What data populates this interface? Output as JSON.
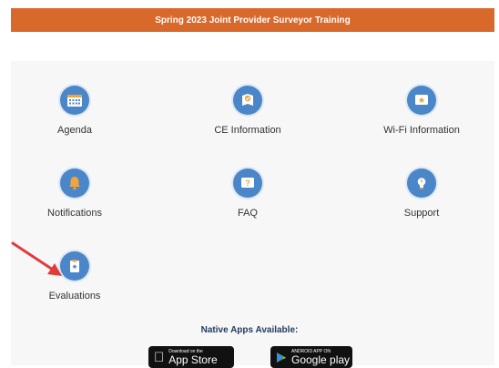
{
  "banner": {
    "title": "Spring 2023 Joint Provider Surveyor Training"
  },
  "tiles": [
    {
      "label": "Agenda",
      "icon": "calendar-icon"
    },
    {
      "label": "CE Information",
      "icon": "badge-icon"
    },
    {
      "label": "Wi-Fi Information",
      "icon": "wifi-card-icon"
    },
    {
      "label": "Notifications",
      "icon": "bell-icon"
    },
    {
      "label": "FAQ",
      "icon": "question-icon"
    },
    {
      "label": "Support",
      "icon": "lightbulb-icon"
    },
    {
      "label": "Evaluations",
      "icon": "clipboard-star-icon"
    }
  ],
  "native_apps": {
    "heading": "Native Apps Available:",
    "app_store": {
      "small": "Download on the",
      "big": "App Store"
    },
    "google_play": {
      "small": "ANDROID APP ON",
      "big": "Google play"
    }
  },
  "colors": {
    "banner": "#d9682b",
    "icon_circle": "#4a86c8",
    "icon_accent": "#f2a33a",
    "annotation_arrow": "#e23b3b"
  }
}
